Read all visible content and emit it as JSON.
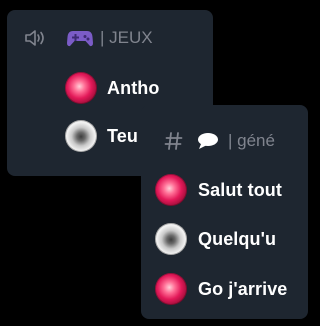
{
  "voice_popup": {
    "channel_label": "| JEUX",
    "members": [
      {
        "name": "Antho"
      },
      {
        "name": "Teu"
      }
    ]
  },
  "text_popup": {
    "channel_label": "| géné",
    "messages": [
      {
        "text": "Salut tout"
      },
      {
        "text": "Quelqu'u"
      },
      {
        "text": "Go j'arrive"
      }
    ]
  },
  "colors": {
    "background": "#000000",
    "panel": "#1e2630",
    "header_text": "#80848e",
    "primary_text": "#ffffff",
    "game_icon": "#7b5cc7"
  }
}
